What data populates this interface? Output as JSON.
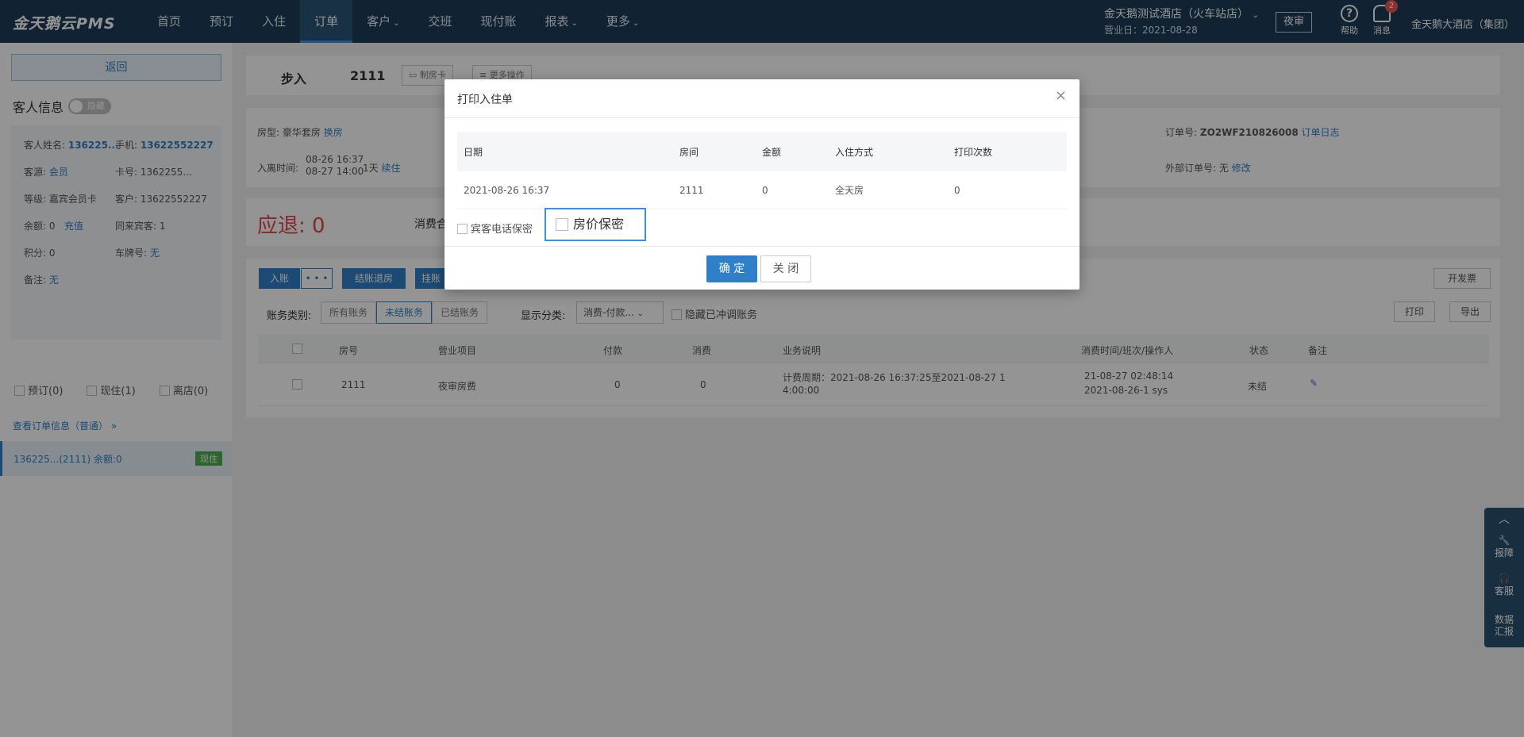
{
  "app": {
    "logo": "金天鹅云PMS"
  },
  "nav": {
    "items": [
      {
        "label": "首页",
        "dropdown": false
      },
      {
        "label": "预订",
        "dropdown": false
      },
      {
        "label": "入住",
        "dropdown": false
      },
      {
        "label": "订单",
        "dropdown": false,
        "active": true
      },
      {
        "label": "客户",
        "dropdown": true
      },
      {
        "label": "交班",
        "dropdown": false
      },
      {
        "label": "现付账",
        "dropdown": false
      },
      {
        "label": "报表",
        "dropdown": true
      },
      {
        "label": "更多",
        "dropdown": true
      }
    ],
    "hotel_name": "金天鹅测试酒店（火车站店）",
    "business_date": "营业日：2021-08-28",
    "night_audit": "夜审",
    "help": "帮助",
    "messages": "消息",
    "message_count": "2",
    "group": "金天鹅大酒店（集团）"
  },
  "left": {
    "back": "返回",
    "guest_info_title": "客人信息",
    "toggle_label": "隐藏",
    "fields": {
      "guest_name_label": "客人姓名:",
      "guest_name": "136225...",
      "phone_label": "手机:",
      "phone": "13622552227",
      "source_label": "客源:",
      "source": "会员",
      "card_label": "卡号:",
      "card": "1362255...",
      "level_label": "等级:",
      "level": "嘉宾会员卡",
      "customer_label": "客户:",
      "customer": "13622552227",
      "balance_label": "余额:",
      "balance": "0",
      "recharge": "充值",
      "companion_label": "同来宾客:",
      "companion": "1",
      "points_label": "积分:",
      "points": "0",
      "plate_label": "车牌号:",
      "plate": "无",
      "remark_label": "备注:",
      "remark": "无"
    },
    "filters": [
      "预订(0)",
      "现住(1)",
      "离店(0)"
    ],
    "order_info_link": "查看订单信息（普通） »",
    "order_item": {
      "text": "136225...(2111)   余额:0",
      "tag": "现住"
    }
  },
  "main": {
    "walkin": "步入",
    "room": "2111",
    "btn_card": "制房卡",
    "btn_more": "更多操作",
    "room_type_label": "房型:",
    "room_type": "豪华套房",
    "change_room": "换房",
    "checkin_label": "入离时间:",
    "checkin_time": "08-26 16:37",
    "checkout_time": "08-27 14:00",
    "nights": "1天",
    "extend": "续住",
    "order_no_label": "订单号:",
    "order_no": "ZO2WF210826008",
    "order_log": "订单日志",
    "ext_order_label": "外部订单号:",
    "ext_order": "无",
    "ext_edit": "修改",
    "refund": "应退: 0",
    "consume_label": "消费合",
    "btn_charge": "入账",
    "btn_more_dots": "• • •",
    "btn_checkout": "结账退房",
    "btn_hang": "挂账",
    "btn_invoice": "开发票",
    "btn_print": "打印",
    "btn_export": "导出",
    "bill_type_label": "账务类别:",
    "bill_tabs": [
      "所有账务",
      "未结账务",
      "已结账务"
    ],
    "display_label": "显示分类:",
    "display_value": "消费-付款...",
    "hide_reversed": "隐藏已冲调账务",
    "grid_headers": [
      "房号",
      "营业项目",
      "付款",
      "消费",
      "业务说明",
      "消费时间/班次/操作人",
      "状态",
      "备注"
    ],
    "grid_row": {
      "room": "2111",
      "item": "夜审房费",
      "pay": "0",
      "consume": "0",
      "desc1": "计费周期：2021-08-26 16:37:25至2021-08-27 1",
      "desc2": "4:00:00",
      "time1": "21-08-27 02:48:14",
      "time2": "2021-08-26-1 sys",
      "status": "未结"
    }
  },
  "float": {
    "repair": "报障",
    "service": "客服",
    "report": "数据汇报"
  },
  "modal": {
    "title": "打印入住单",
    "headers": [
      "日期",
      "房间",
      "金额",
      "入住方式",
      "打印次数"
    ],
    "row": [
      "2021-08-26 16:37",
      "2111",
      "0",
      "全天房",
      "0"
    ],
    "opt_phone": "宾客电话保密",
    "opt_price": "房价保密",
    "ok": "确 定",
    "close": "关 闭"
  }
}
